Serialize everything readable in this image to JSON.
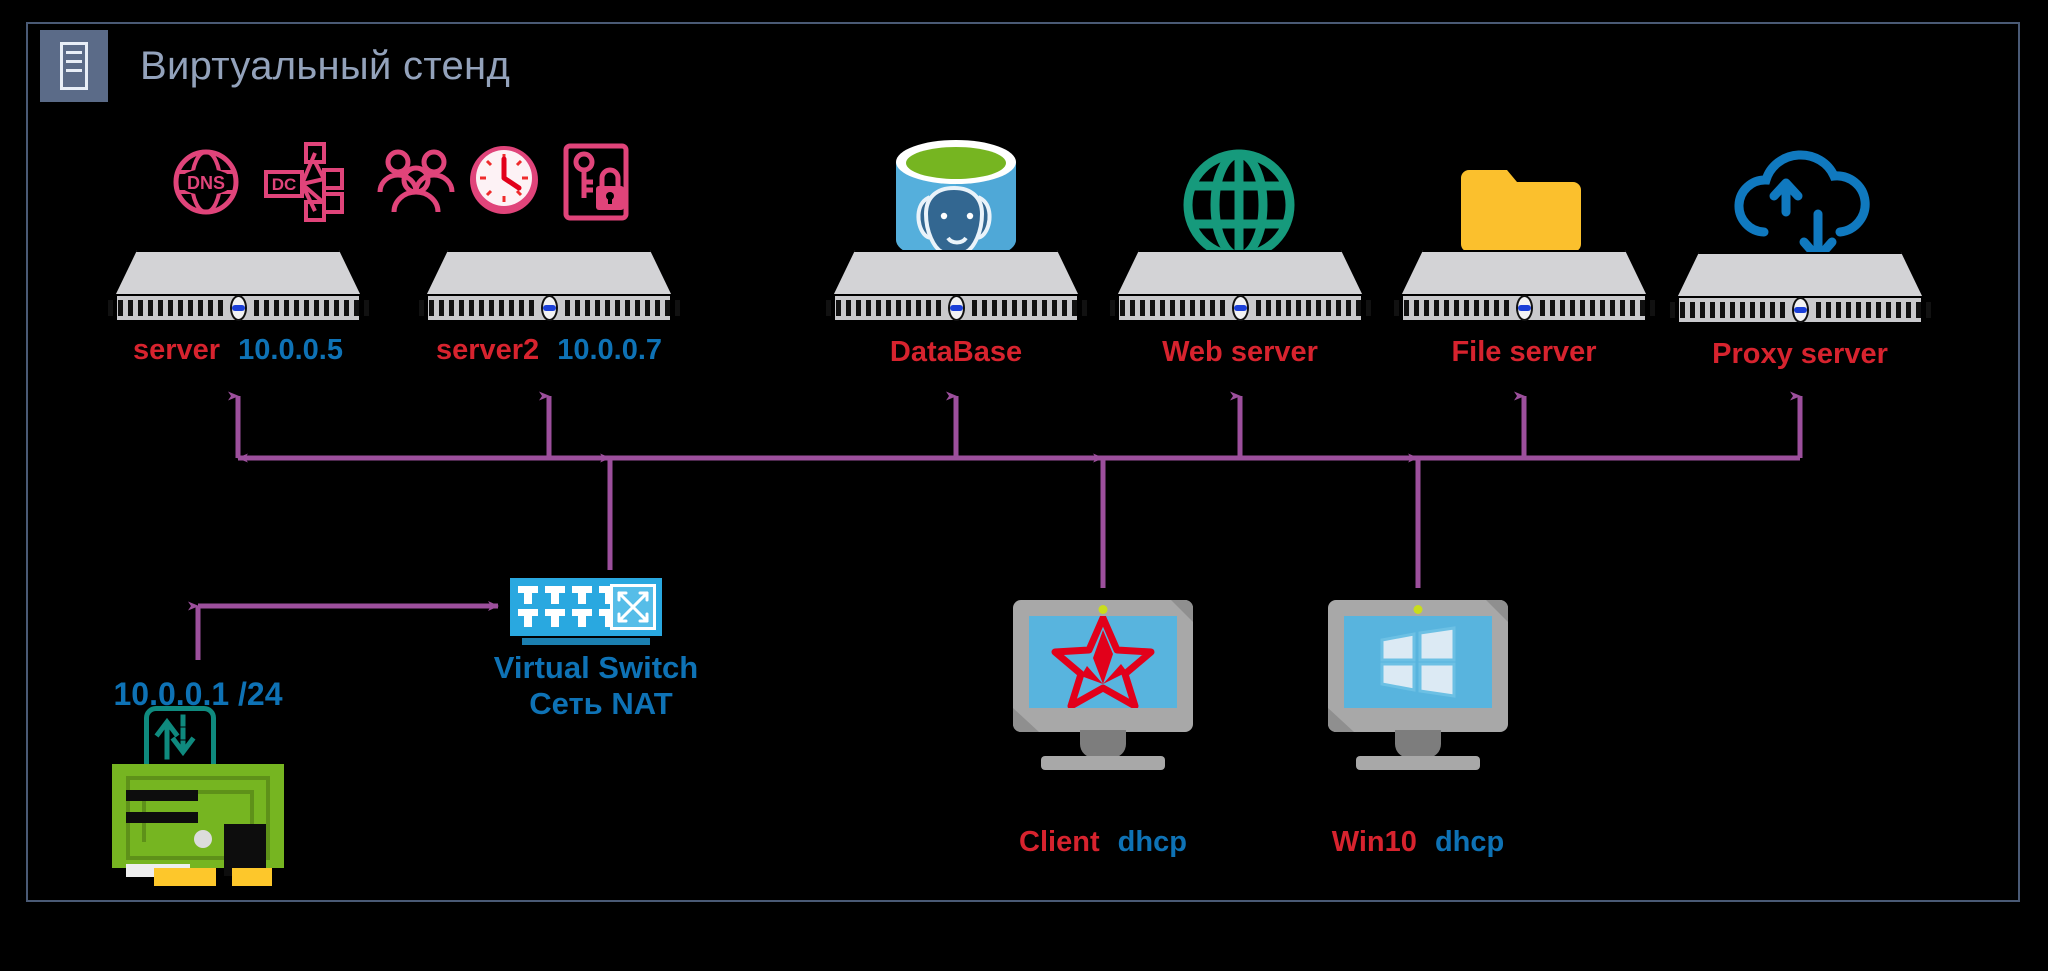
{
  "window": {
    "title": "Виртуальный стенд",
    "title_icon": "server-rack-icon",
    "frame_color": "#4a5a75",
    "badge_color": "#5b6b88",
    "title_color": "#93a2bb",
    "background": "#000000"
  },
  "colors": {
    "label_red": "#d7232e",
    "label_blue": "#0e72b5",
    "connector": "#9c4f9c",
    "service_icon_pink": "#e0447a",
    "switch_blue": "#29a8e0",
    "nic_green": "#76b521",
    "folder_yellow": "#fbc02d",
    "globe_teal": "#169a7c",
    "cloud_blue": "#1079bf",
    "star_red": "#e2001a"
  },
  "service_icons": [
    {
      "name": "dns-icon",
      "label": "DNS"
    },
    {
      "name": "domain-controller-icon",
      "label": "DC"
    },
    {
      "name": "users-group-icon",
      "label": ""
    },
    {
      "name": "clock-ntp-icon",
      "label": ""
    },
    {
      "name": "certificate-key-lock-icon",
      "label": ""
    }
  ],
  "nodes": [
    {
      "id": "server",
      "name_label": "server",
      "addr_label": "10.0.0.5",
      "icon": "rack-server-icon"
    },
    {
      "id": "server2",
      "name_label": "server2",
      "addr_label": "10.0.0.7",
      "icon": "rack-server-icon"
    },
    {
      "id": "database",
      "name_label": "DataBase",
      "addr_label": "",
      "icon": "postgresql-database-icon"
    },
    {
      "id": "web",
      "name_label": "Web server",
      "addr_label": "",
      "icon": "globe-icon"
    },
    {
      "id": "file",
      "name_label": "File server",
      "addr_label": "",
      "icon": "shared-folder-icon"
    },
    {
      "id": "proxy",
      "name_label": "Proxy server",
      "addr_label": "",
      "icon": "cloud-transfer-icon"
    }
  ],
  "switch": {
    "line1": "Virtual Switch",
    "line2": "Сеть NAT",
    "icon": "network-switch-icon"
  },
  "nic": {
    "address": "10.0.0.1 /24",
    "icon": "network-interface-card-icon",
    "badge_icon": "data-transfer-arrows-icon"
  },
  "clients": [
    {
      "id": "client",
      "name_label": "Client",
      "addr_label": "dhcp",
      "icon": "astra-linux-star-icon"
    },
    {
      "id": "win10",
      "name_label": "Win10",
      "addr_label": "dhcp",
      "icon": "windows-logo-icon"
    }
  ]
}
